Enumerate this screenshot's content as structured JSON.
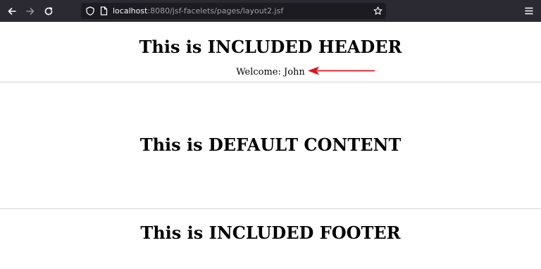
{
  "browser": {
    "url_host": "localhost",
    "url_path": ":8080/jsf-facelets/pages/layout2.jsf",
    "toolbar_bg": "#2b2a33",
    "urlbar_bg": "#1c1b22",
    "icons": [
      "back-icon",
      "forward-icon",
      "reload-icon",
      "shield-icon",
      "page-icon",
      "star-icon",
      "menu-icon"
    ]
  },
  "page": {
    "header_title": "This is INCLUDED HEADER",
    "welcome_text": "Welcome: John",
    "content_title": "This is DEFAULT CONTENT",
    "footer_title": "This is INCLUDED FOOTER",
    "annotation_color": "#e3101a"
  }
}
